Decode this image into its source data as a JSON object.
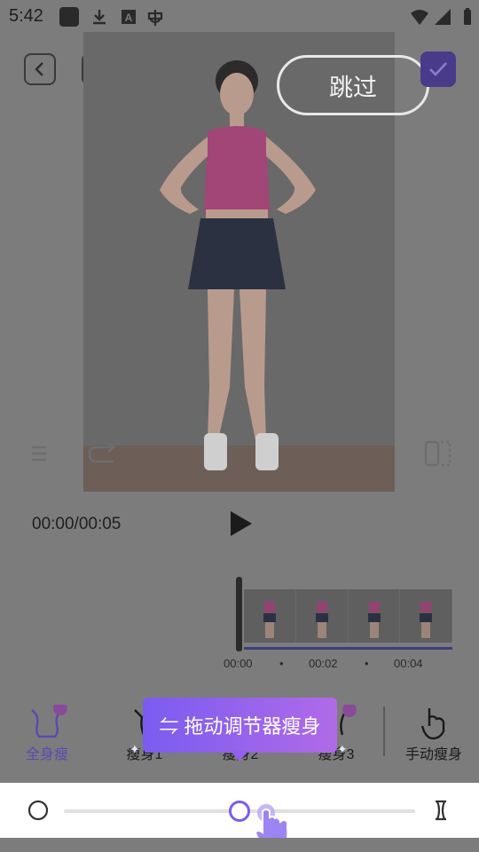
{
  "status_bar": {
    "time": "5:42"
  },
  "header": {
    "skip_label": "跳过"
  },
  "player": {
    "timecode": "00:00/00:05"
  },
  "timeline": {
    "ticks": [
      "00:00",
      "00:02",
      "00:04"
    ]
  },
  "tools": [
    {
      "label": "全身瘦",
      "active": true
    },
    {
      "label": "瘦身1"
    },
    {
      "label": "瘦身2"
    },
    {
      "label": "瘦身3"
    },
    {
      "label": "手动瘦身"
    }
  ],
  "tooltip": {
    "text": "⇋ 拖动调节器瘦身"
  },
  "slider": {
    "value_fraction": 0.5
  },
  "colors": {
    "accent": "#7b5cf0",
    "active_tool": "#5a4ab0"
  }
}
